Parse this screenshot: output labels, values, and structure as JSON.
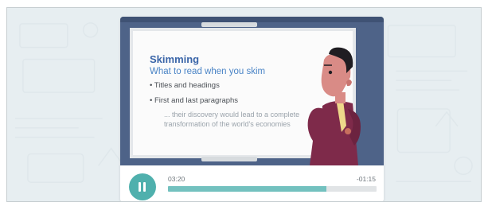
{
  "slide": {
    "title": "Skimming",
    "subtitle": "What to read when you skim",
    "bullets": [
      "• Titles and headings",
      "• First and last paragraphs"
    ],
    "quote_line1": "... their discovery would lead to a complete",
    "quote_line2": "transformation of the world's economies"
  },
  "player": {
    "state": "playing",
    "current_time": "03:20",
    "remaining_time": "-01:15",
    "progress": 0.76,
    "accent_color": "#4fb0ad"
  },
  "icons": {
    "toggle": "pause-icon"
  }
}
